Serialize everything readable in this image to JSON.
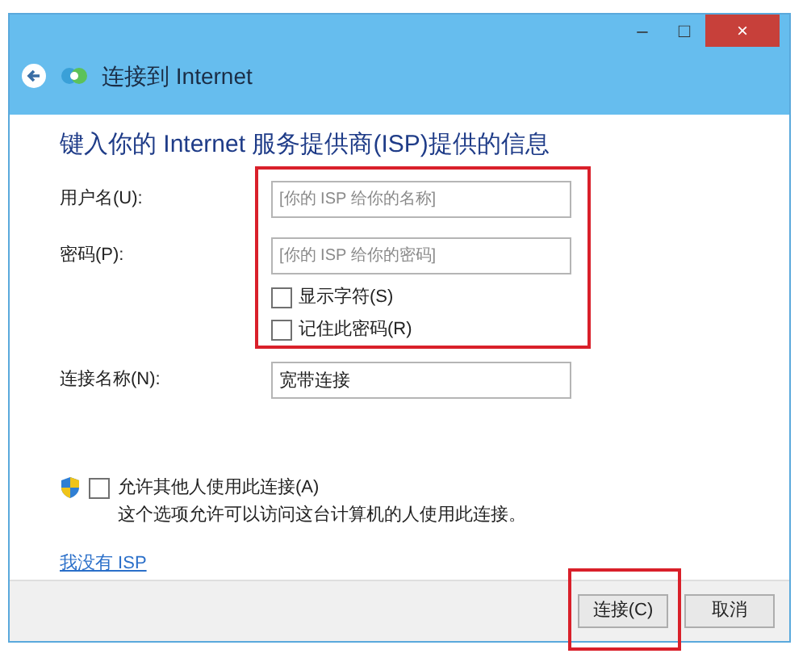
{
  "window": {
    "title": "连接到 Internet",
    "controls": [
      {
        "kind": "minimize",
        "label": "–"
      },
      {
        "kind": "maximize",
        "label": "□"
      },
      {
        "kind": "close",
        "label": "×"
      }
    ]
  },
  "heading": "键入你的 Internet 服务提供商(ISP)提供的信息",
  "credentials": {
    "highlighted": true,
    "fields": [
      {
        "label": "用户名(U):",
        "placeholder": "[你的 ISP 给你的名称]"
      },
      {
        "label": "密码(P):",
        "placeholder": "[你的 ISP 给你的密码]"
      }
    ],
    "options": [
      {
        "label": "显示字符(S)",
        "checked": false
      },
      {
        "label": "记住此密码(R)",
        "checked": false
      }
    ]
  },
  "connection_name": {
    "label": "连接名称(N):",
    "value": "宽带连接"
  },
  "allow_others": {
    "label": "允许其他人使用此连接(A)",
    "checked": false,
    "description": "这个选项允许可以访问这台计算机的人使用此连接。"
  },
  "link": "我没有 ISP",
  "connect_button": {
    "label": "连接(C)",
    "highlighted": true
  },
  "cancel_button": {
    "label": "取消"
  }
}
